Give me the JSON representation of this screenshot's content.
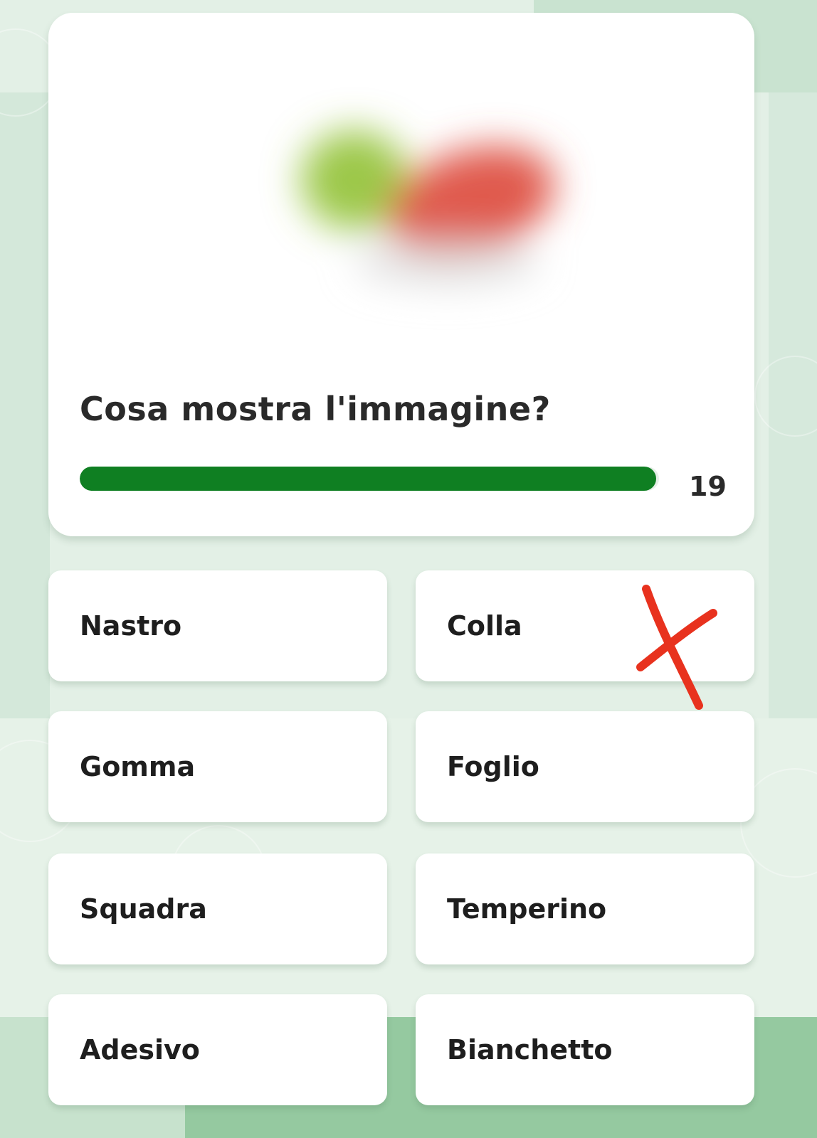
{
  "quiz": {
    "question": "Cosa mostra l'immagine?",
    "timer": {
      "count": "19",
      "fill_fraction": 0.995,
      "color": "#0f7f22"
    },
    "image": {
      "description_icon": "blurred-image",
      "colors": [
        "#9cc84a",
        "#e05a4e"
      ]
    },
    "answers": [
      {
        "label": "Nastro"
      },
      {
        "label": "Colla",
        "marked_wrong": true
      },
      {
        "label": "Gomma"
      },
      {
        "label": "Foglio"
      },
      {
        "label": "Squadra"
      },
      {
        "label": "Temperino"
      },
      {
        "label": "Adesivo"
      },
      {
        "label": "Bianchetto"
      }
    ],
    "wrong_mark_color": "#e8321e"
  }
}
